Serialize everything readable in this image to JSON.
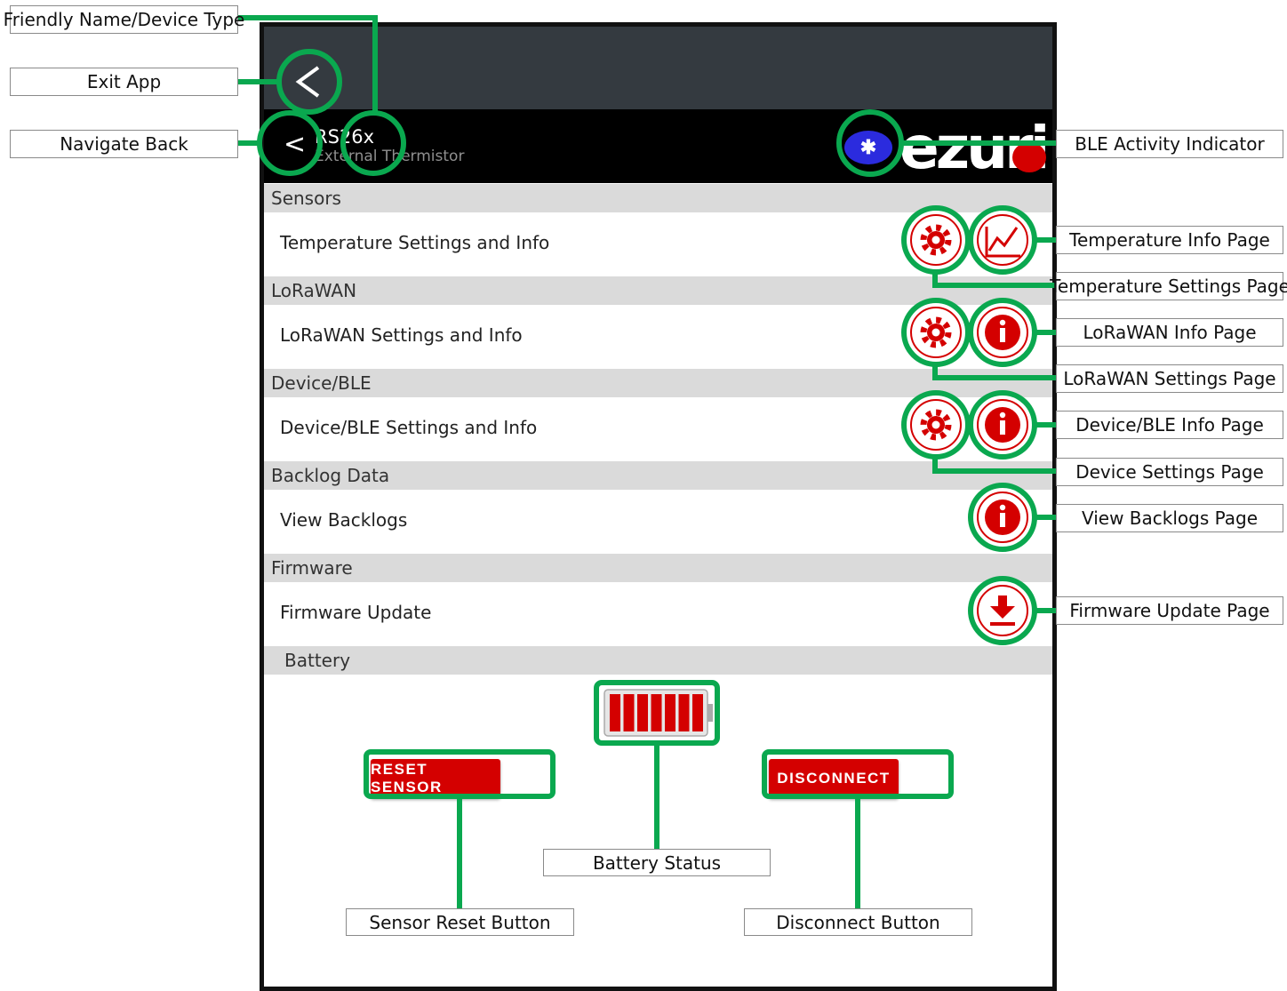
{
  "device": {
    "name": "RS26x",
    "type": "External Thermistor",
    "logo_text": "ezurio"
  },
  "sections": [
    {
      "header": "Sensors",
      "row": "Temperature Settings and Info"
    },
    {
      "header": "LoRaWAN",
      "row": "LoRaWAN Settings and Info"
    },
    {
      "header": "Device/BLE",
      "row": "Device/BLE Settings and Info"
    },
    {
      "header": "Backlog Data",
      "row": "View Backlogs"
    },
    {
      "header": "Firmware",
      "row": "Firmware Update"
    }
  ],
  "battery": {
    "header": "Battery",
    "level": 1.0
  },
  "buttons": {
    "reset": "RESET SENSOR",
    "disconnect": "DISCONNECT"
  },
  "callouts": {
    "friendly_name": "Friendly Name/Device Type",
    "exit_app": "Exit App",
    "navigate_back": "Navigate Back",
    "ble_activity": "BLE Activity Indicator",
    "temp_info": "Temperature Info Page",
    "temp_settings": "Temperature Settings Page",
    "lorawan_info": "LoRaWAN Info Page",
    "lorawan_settings": "LoRaWAN Settings Page",
    "device_info": "Device/BLE Info Page",
    "device_settings": "Device Settings Page",
    "view_backlogs": "View Backlogs Page",
    "firmware_update": "Firmware Update Page",
    "battery_status": "Battery Status",
    "sensor_reset": "Sensor Reset Button",
    "disconnect_button": "Disconnect Button"
  },
  "colors": {
    "accent_red": "#d40000",
    "callout_green": "#0aa84f",
    "ble_blue": "#2b2bde",
    "status_bar": "#343a40"
  },
  "icons": {
    "exit": "chevron-left-icon",
    "back": "chevron-left-icon",
    "ble": "bluetooth-icon",
    "settings": "gear-icon",
    "info": "info-icon",
    "chart": "line-chart-icon",
    "download": "download-icon",
    "battery": "battery-icon"
  }
}
